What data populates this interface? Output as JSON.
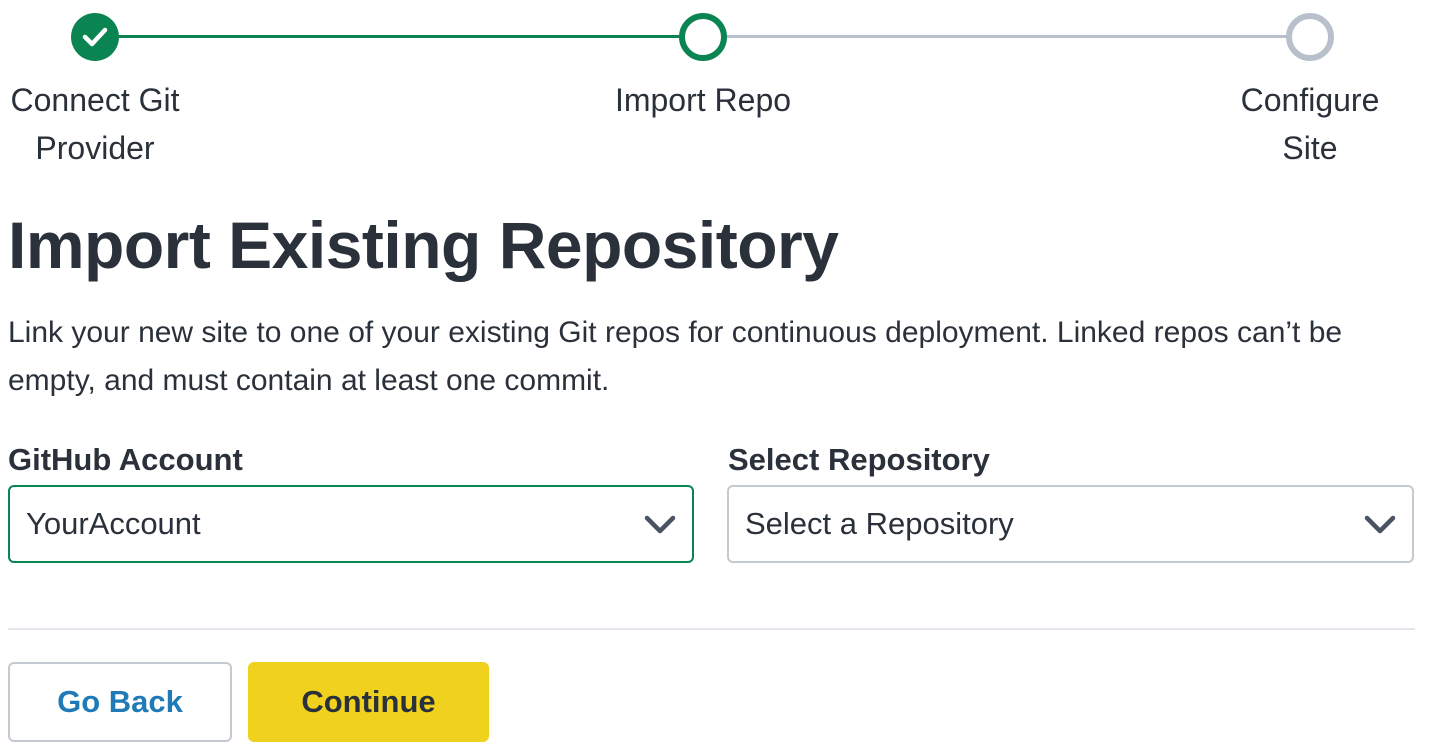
{
  "colors": {
    "success_green": "#0a8551",
    "pending_gray": "#b8c1cb",
    "text_dark": "#2b313a",
    "link_blue": "#1f7ab7",
    "primary_yellow": "#f0d11e"
  },
  "stepper": {
    "steps": [
      {
        "label": "Connect Git\nProvider",
        "state": "complete",
        "icon": "check-icon"
      },
      {
        "label": "Import Repo",
        "state": "current"
      },
      {
        "label": "Configure\nSite",
        "state": "pending"
      }
    ]
  },
  "main": {
    "title": "Import Existing Repository",
    "description": "Link your new site to one of your existing Git repos for continuous deployment. Linked repos can’t be empty, and must contain at least one commit."
  },
  "form": {
    "account": {
      "label": "GitHub Account",
      "value": "YourAccount",
      "icon": "chevron-down-icon"
    },
    "repository": {
      "label": "Select Repository",
      "placeholder": "Select a Repository",
      "icon": "chevron-down-icon"
    }
  },
  "actions": {
    "back_label": "Go Back",
    "continue_label": "Continue"
  }
}
